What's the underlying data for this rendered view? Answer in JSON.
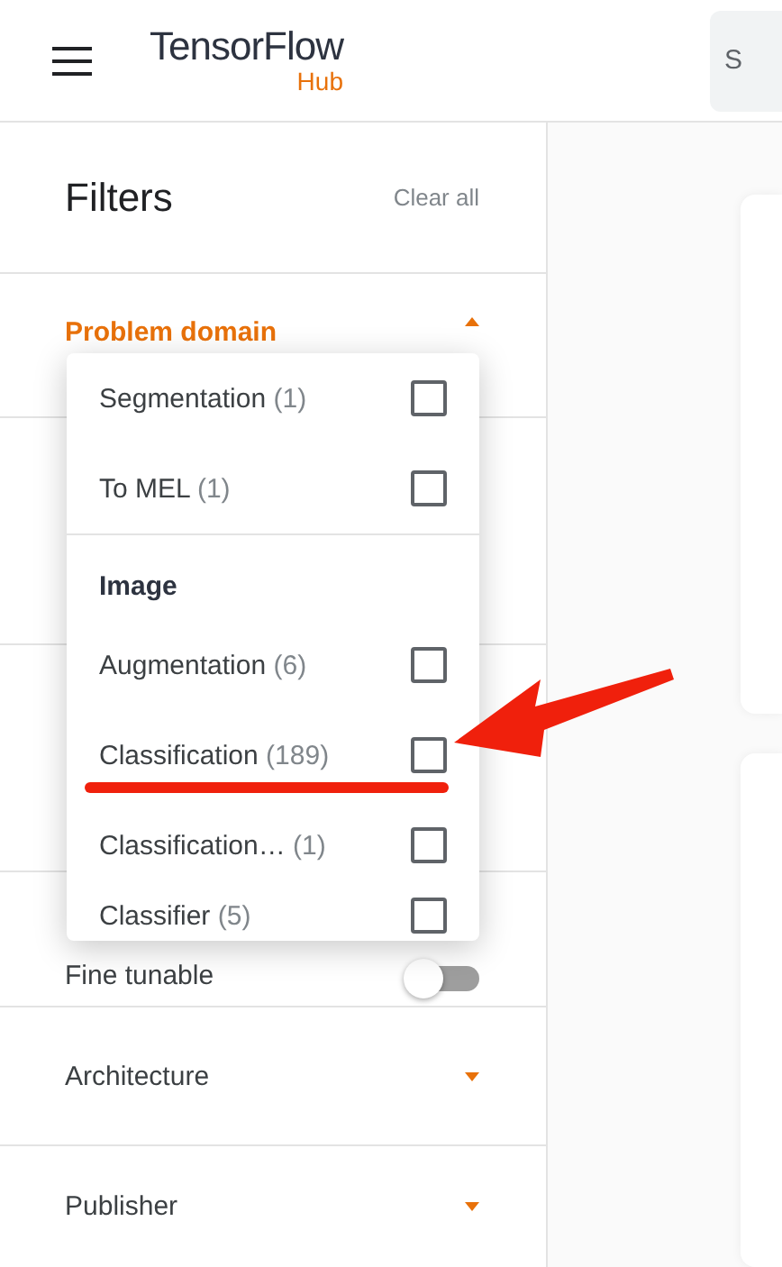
{
  "header": {
    "logo": "TensorFlow",
    "logo_sub": "Hub",
    "search": {
      "placeholder": "S"
    }
  },
  "filters": {
    "title": "Filters",
    "clear": "Clear all",
    "sections": [
      {
        "kind": "accordion",
        "label": "Problem domain",
        "expanded": true
      },
      {
        "kind": "blank"
      },
      {
        "kind": "blank"
      },
      {
        "kind": "toggle",
        "label": "Fine tunable",
        "on": false
      },
      {
        "kind": "accordion",
        "label": "Architecture",
        "expanded": false
      },
      {
        "kind": "accordion",
        "label": "Publisher",
        "expanded": false
      }
    ]
  },
  "dropdown": {
    "groups": [
      {
        "items": [
          {
            "label": "Segmentation",
            "count": "(1)",
            "checked": false
          },
          {
            "label": "To MEL",
            "count": "(1)",
            "checked": false
          }
        ]
      },
      {
        "heading": "Image",
        "items": [
          {
            "label": "Augmentation",
            "count": "(6)",
            "checked": false
          },
          {
            "label": "Classification",
            "count": "(189)",
            "checked": false
          },
          {
            "label": "Classification…",
            "count": "(1)",
            "checked": false
          },
          {
            "label": "Classifier",
            "count": "(5)",
            "checked": false
          }
        ]
      }
    ]
  }
}
